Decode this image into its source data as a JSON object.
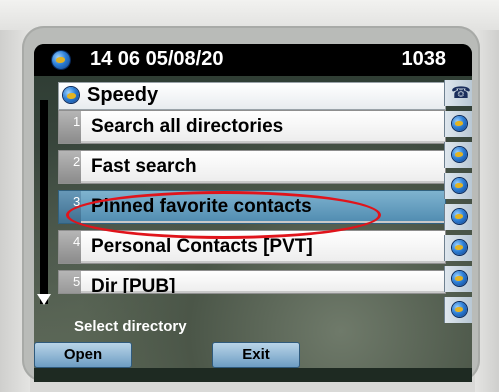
{
  "status": {
    "line": "14 06 05/08/20",
    "extension": "1038"
  },
  "title": "Speedy",
  "items": [
    {
      "num": "1",
      "label": "Search all directories"
    },
    {
      "num": "2",
      "label": "Fast search"
    },
    {
      "num": "3",
      "label": "Pinned favorite contacts",
      "selected": true
    },
    {
      "num": "4",
      "label": "Personal Contacts [PVT]"
    },
    {
      "num": "5",
      "label": "Dir [PUB]"
    }
  ],
  "prompt": "Select directory",
  "softkeys": {
    "open": "Open",
    "exit": "Exit"
  },
  "colors": {
    "selected_row": "#5a93b8",
    "highlight_circle": "#e0141b"
  },
  "icons": {
    "status": "globe-icon",
    "linekey_1": "phone-icon",
    "linekeys_rest": "globe-icon"
  }
}
